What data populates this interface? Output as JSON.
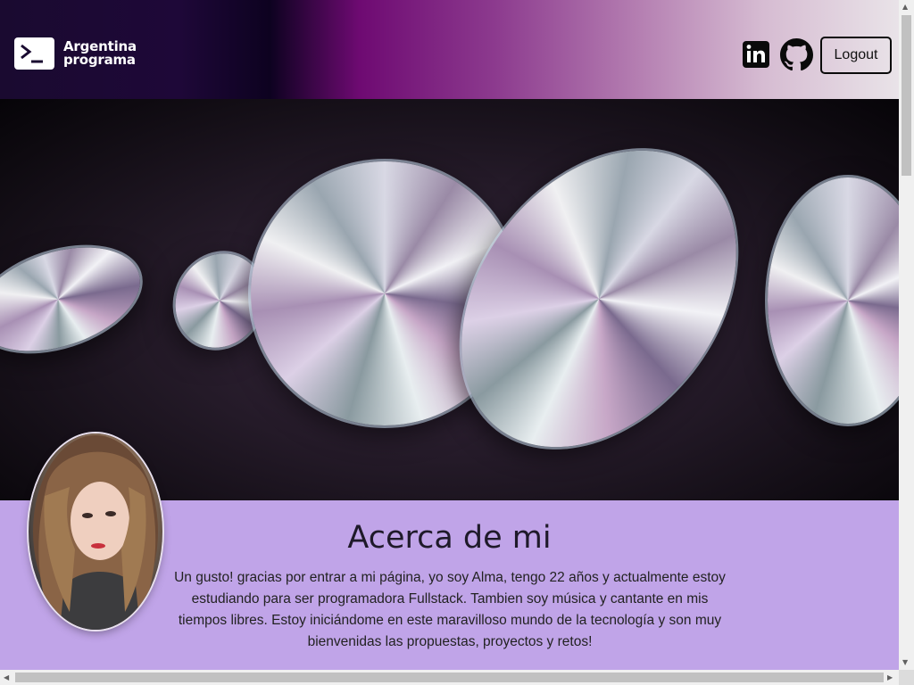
{
  "header": {
    "logo_line1": "Argentina",
    "logo_line2": "programa",
    "logout_label": "Logout",
    "linkedin_icon": "linkedin-icon",
    "github_icon": "github-icon"
  },
  "banner": {
    "image": "holographic-discs-banner"
  },
  "about": {
    "title": "Acerca de mi",
    "text": "Un gusto! gracias por entrar a mi página, yo soy Alma, tengo 22 años y actualmente estoy estudiando para ser programadora Fullstack. Tambien soy música y cantante en mis tiempos libres. Estoy iniciándome en este maravilloso mundo de la tecnología y son muy bienvenidas las propuestas, proyectos y retos!",
    "avatar": "profile-photo",
    "background": "#c0a4e8"
  },
  "scrollbar": {
    "up_arrow": "▲",
    "down_arrow": "▼",
    "left_arrow": "◀",
    "right_arrow": "▶"
  }
}
